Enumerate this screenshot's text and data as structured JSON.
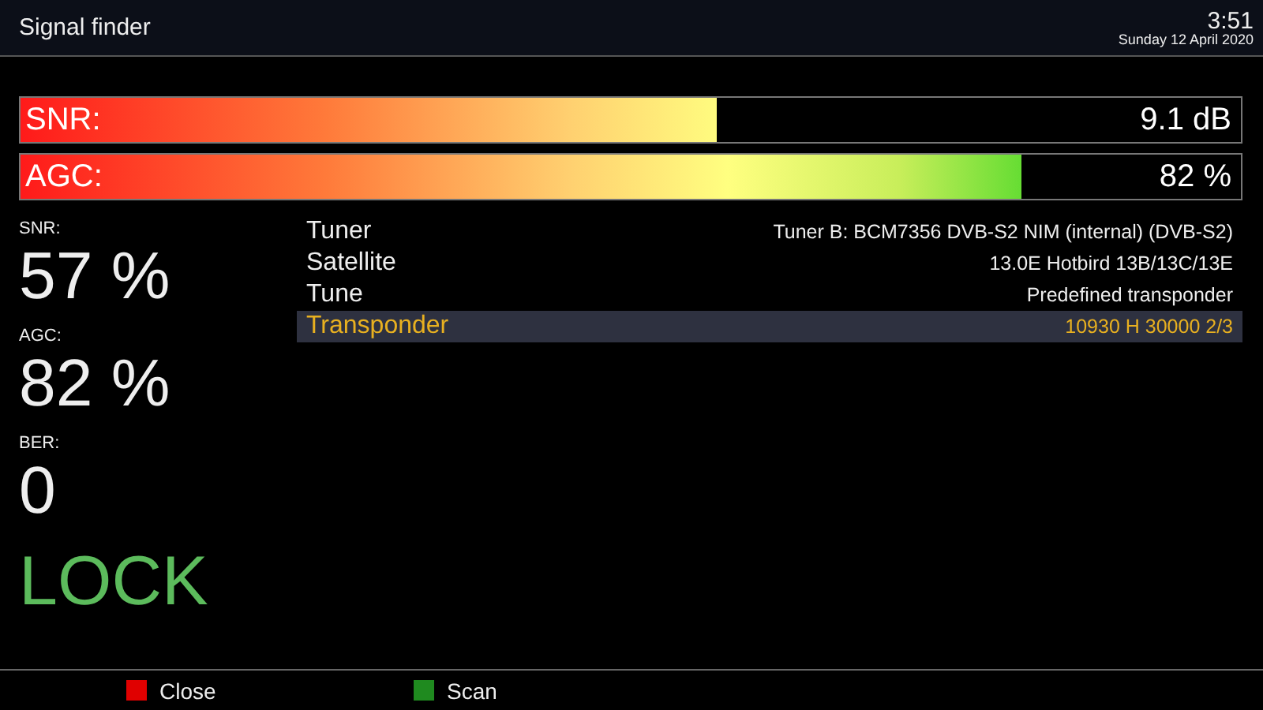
{
  "window": {
    "title": "Signal finder",
    "time": "3:51",
    "date": "Sunday 12 April 2020"
  },
  "bars": [
    {
      "label": "SNR:",
      "level": 0.57,
      "reading": "9.1 dB"
    },
    {
      "label": "AGC:",
      "level": 0.82,
      "reading": "82 %"
    }
  ],
  "stats": [
    {
      "label": "SNR:",
      "value": "57 %"
    },
    {
      "label": "AGC:",
      "value": "82 %"
    },
    {
      "label": "BER:",
      "value": "0"
    }
  ],
  "status": {
    "text": "LOCK",
    "locked": true
  },
  "settings": [
    {
      "label": "Tuner",
      "value": "Tuner B: BCM7356 DVB-S2 NIM (internal) (DVB-S2)",
      "selected": false
    },
    {
      "label": "Satellite",
      "value": "13.0E Hotbird 13B/13C/13E",
      "selected": false
    },
    {
      "label": "Tune",
      "value": "Predefined transponder",
      "selected": false
    },
    {
      "label": "Transponder",
      "value": "10930 H 30000 2/3",
      "selected": true
    }
  ],
  "buttons": [
    {
      "label": "Close",
      "color": "#e00000"
    },
    {
      "label": "Scan",
      "color": "#1f8a1f"
    }
  ]
}
